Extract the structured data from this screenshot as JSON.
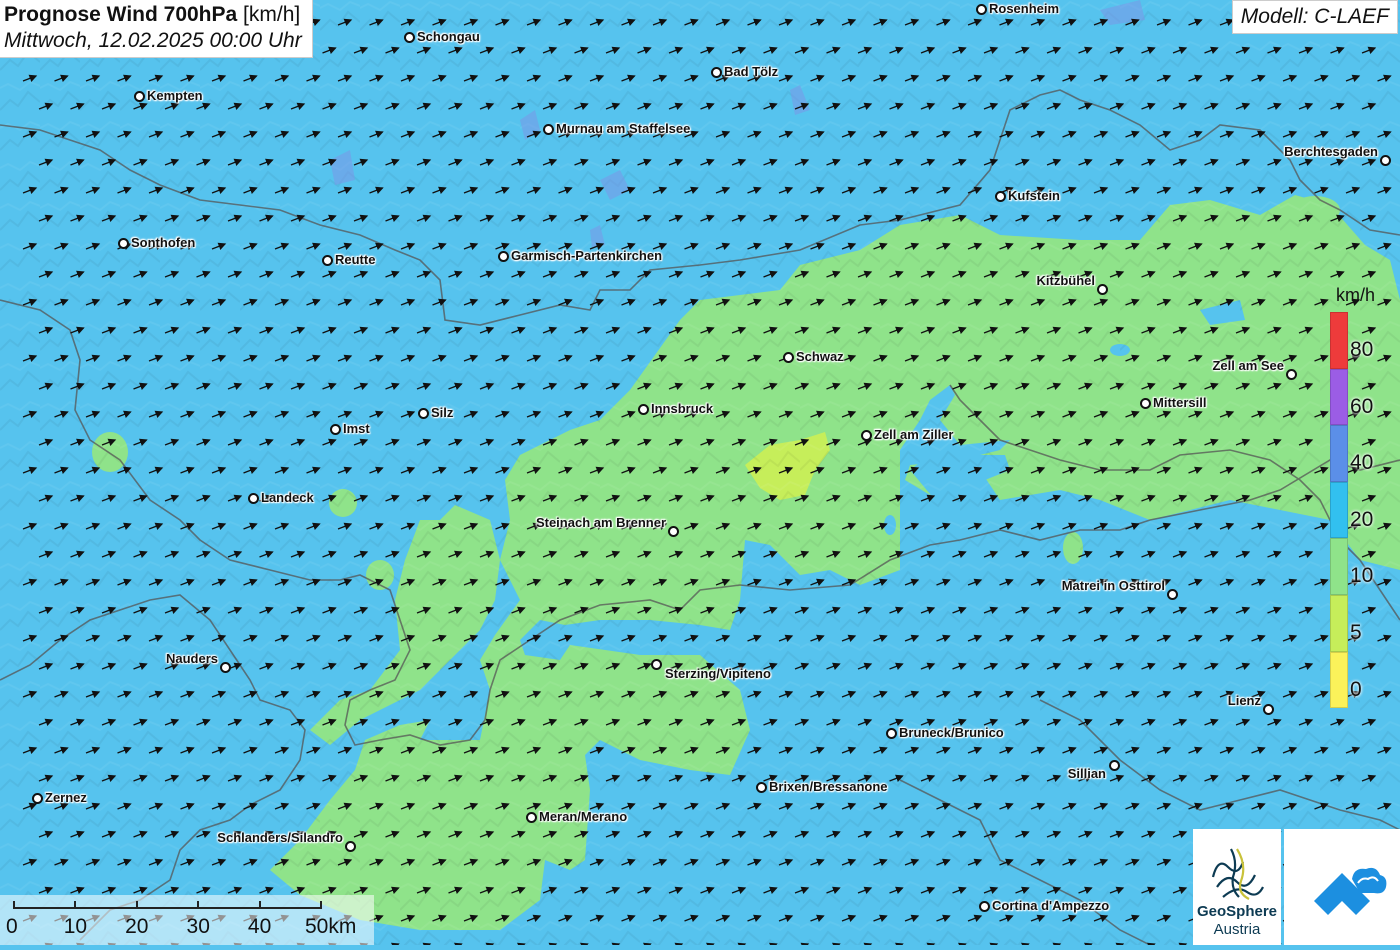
{
  "title": {
    "main_bold": "Prognose Wind 700hPa",
    "unit": "[km/h]",
    "subtitle": "Mittwoch, 12.02.2025 00:00 Uhr"
  },
  "model_label": "Modell: C-LAEF",
  "legend": {
    "unit": "km/h",
    "levels": [
      {
        "label": "80",
        "color": "#ee3b3b"
      },
      {
        "label": "60",
        "color": "#9b5de5"
      },
      {
        "label": "40",
        "color": "#5b8fe8"
      },
      {
        "label": "20",
        "color": "#32c0ef"
      },
      {
        "label": "10",
        "color": "#8fe38a"
      },
      {
        "label": "5",
        "color": "#c6ee5a"
      },
      {
        "label": "0",
        "color": "#fbf25a"
      }
    ]
  },
  "scale": {
    "labels": [
      "0",
      "10",
      "20",
      "30",
      "40",
      "50km"
    ]
  },
  "cities": [
    "Rosenheim",
    "Schongau",
    "Bad Tölz",
    "Kempten",
    "Murnau am Staffelsee",
    "Berchtesgaden",
    "Kufstein",
    "Sonthofen",
    "Reutte",
    "Garmisch-Partenkirchen",
    "Kitzbühel",
    "Schwaz",
    "Zell am See",
    "Mittersill",
    "Silz",
    "Innsbruck",
    "Imst",
    "Zell am Ziller",
    "Landeck",
    "Steinach am Brenner",
    "Matrei in Osttirol",
    "Nauders",
    "Sterzing/Vipiteno",
    "Lienz",
    "Bruneck/Brunico",
    "Sillian",
    "Brixen/Bressanone",
    "Zernez",
    "Meran/Merano",
    "Schlanders/Silandro",
    "Cortina d'Ampezzo"
  ],
  "logo": {
    "line1": "GeoSphere",
    "line2": "Austria"
  }
}
